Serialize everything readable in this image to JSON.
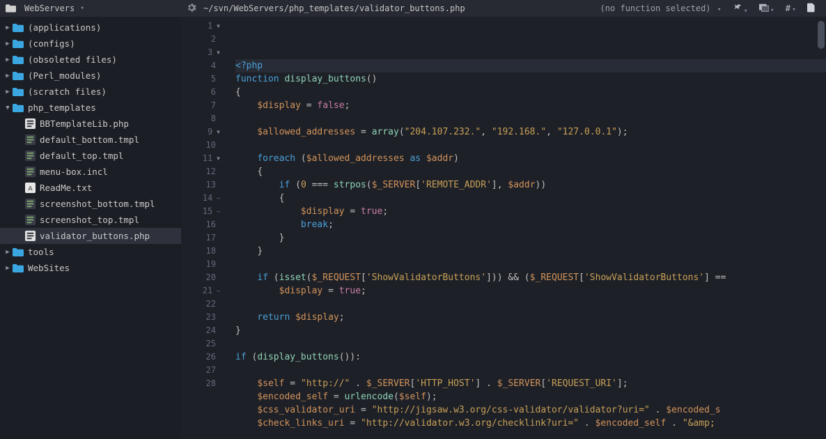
{
  "topbar": {
    "project": "WebServers",
    "path": "~/svn/WebServers/php_templates/validator_buttons.php",
    "fn_selector": "(no function selected)"
  },
  "tree": [
    {
      "kind": "folder",
      "name": "(applications)",
      "indent": 0,
      "open": false
    },
    {
      "kind": "folder",
      "name": "(configs)",
      "indent": 0,
      "open": false
    },
    {
      "kind": "folder",
      "name": "(obsoleted files)",
      "indent": 0,
      "open": false
    },
    {
      "kind": "folder",
      "name": "(Perl_modules)",
      "indent": 0,
      "open": false
    },
    {
      "kind": "folder",
      "name": "(scratch files)",
      "indent": 0,
      "open": false
    },
    {
      "kind": "folder",
      "name": "php_templates",
      "indent": 0,
      "open": true
    },
    {
      "kind": "php",
      "name": "BBTemplateLib.php",
      "indent": 1
    },
    {
      "kind": "file",
      "name": "default_bottom.tmpl",
      "indent": 1
    },
    {
      "kind": "file",
      "name": "default_top.tmpl",
      "indent": 1
    },
    {
      "kind": "file",
      "name": "menu-box.incl",
      "indent": 1
    },
    {
      "kind": "txt",
      "name": "ReadMe.txt",
      "indent": 1
    },
    {
      "kind": "file",
      "name": "screenshot_bottom.tmpl",
      "indent": 1
    },
    {
      "kind": "file",
      "name": "screenshot_top.tmpl",
      "indent": 1
    },
    {
      "kind": "php",
      "name": "validator_buttons.php",
      "indent": 1,
      "selected": true
    },
    {
      "kind": "folder",
      "name": "tools",
      "indent": 0,
      "open": false
    },
    {
      "kind": "folder",
      "name": "WebSites",
      "indent": 0,
      "open": false
    }
  ],
  "code": {
    "lines": [
      {
        "n": 1,
        "fold": "▼",
        "hl": true,
        "tokens": [
          [
            "kw",
            "<?php"
          ]
        ]
      },
      {
        "n": 2,
        "tokens": [
          [
            "kw",
            "function"
          ],
          [
            "op",
            " "
          ],
          [
            "fn",
            "display_buttons"
          ],
          [
            "punct",
            "()"
          ]
        ]
      },
      {
        "n": 3,
        "fold": "▼",
        "tokens": [
          [
            "punct",
            "{"
          ]
        ]
      },
      {
        "n": 4,
        "tokens": [
          [
            "op",
            "    "
          ],
          [
            "var",
            "$display"
          ],
          [
            "op",
            " = "
          ],
          [
            "const",
            "false"
          ],
          [
            "punct",
            ";"
          ]
        ]
      },
      {
        "n": 5,
        "tokens": []
      },
      {
        "n": 6,
        "tokens": [
          [
            "op",
            "    "
          ],
          [
            "var",
            "$allowed_addresses"
          ],
          [
            "op",
            " = "
          ],
          [
            "fn",
            "array"
          ],
          [
            "punct",
            "("
          ],
          [
            "str",
            "\"204.107.232.\""
          ],
          [
            "punct",
            ", "
          ],
          [
            "str",
            "\"192.168.\""
          ],
          [
            "punct",
            ", "
          ],
          [
            "str",
            "\"127.0.0.1\""
          ],
          [
            "punct",
            ");"
          ]
        ]
      },
      {
        "n": 7,
        "tokens": []
      },
      {
        "n": 8,
        "tokens": [
          [
            "op",
            "    "
          ],
          [
            "kw",
            "foreach"
          ],
          [
            "op",
            " ("
          ],
          [
            "var",
            "$allowed_addresses"
          ],
          [
            "op",
            " "
          ],
          [
            "kw",
            "as"
          ],
          [
            "op",
            " "
          ],
          [
            "var",
            "$addr"
          ],
          [
            "punct",
            ")"
          ]
        ]
      },
      {
        "n": 9,
        "fold": "▼",
        "tokens": [
          [
            "op",
            "    "
          ],
          [
            "punct",
            "{"
          ]
        ]
      },
      {
        "n": 10,
        "tokens": [
          [
            "op",
            "        "
          ],
          [
            "kw",
            "if"
          ],
          [
            "op",
            " ("
          ],
          [
            "num",
            "0"
          ],
          [
            "op",
            " === "
          ],
          [
            "fn",
            "strpos"
          ],
          [
            "punct",
            "("
          ],
          [
            "var",
            "$_SERVER"
          ],
          [
            "punct",
            "["
          ],
          [
            "str",
            "'REMOTE_ADDR'"
          ],
          [
            "punct",
            "], "
          ],
          [
            "var",
            "$addr"
          ],
          [
            "punct",
            "))"
          ]
        ]
      },
      {
        "n": 11,
        "fold": "▼",
        "tokens": [
          [
            "op",
            "        "
          ],
          [
            "punct",
            "{"
          ]
        ]
      },
      {
        "n": 12,
        "tokens": [
          [
            "op",
            "            "
          ],
          [
            "var",
            "$display"
          ],
          [
            "op",
            " = "
          ],
          [
            "const",
            "true"
          ],
          [
            "punct",
            ";"
          ]
        ]
      },
      {
        "n": 13,
        "tokens": [
          [
            "op",
            "            "
          ],
          [
            "kw",
            "break"
          ],
          [
            "punct",
            ";"
          ]
        ]
      },
      {
        "n": 14,
        "fold": "–",
        "tokens": [
          [
            "op",
            "        "
          ],
          [
            "punct",
            "}"
          ]
        ]
      },
      {
        "n": 15,
        "fold": "–",
        "tokens": [
          [
            "op",
            "    "
          ],
          [
            "punct",
            "}"
          ]
        ]
      },
      {
        "n": 16,
        "tokens": []
      },
      {
        "n": 17,
        "tokens": [
          [
            "op",
            "    "
          ],
          [
            "kw",
            "if"
          ],
          [
            "op",
            " ("
          ],
          [
            "fn",
            "isset"
          ],
          [
            "punct",
            "("
          ],
          [
            "var",
            "$_REQUEST"
          ],
          [
            "punct",
            "["
          ],
          [
            "str",
            "'ShowValidatorButtons'"
          ],
          [
            "punct",
            "])) && ("
          ],
          [
            "var",
            "$_REQUEST"
          ],
          [
            "punct",
            "["
          ],
          [
            "str",
            "'ShowValidatorButtons'"
          ],
          [
            "punct",
            "] =="
          ]
        ]
      },
      {
        "n": 18,
        "tokens": [
          [
            "op",
            "        "
          ],
          [
            "var",
            "$display"
          ],
          [
            "op",
            " = "
          ],
          [
            "const",
            "true"
          ],
          [
            "punct",
            ";"
          ]
        ]
      },
      {
        "n": 19,
        "tokens": []
      },
      {
        "n": 20,
        "tokens": [
          [
            "op",
            "    "
          ],
          [
            "kw",
            "return"
          ],
          [
            "op",
            " "
          ],
          [
            "var",
            "$display"
          ],
          [
            "punct",
            ";"
          ]
        ]
      },
      {
        "n": 21,
        "fold": "–",
        "tokens": [
          [
            "punct",
            "}"
          ]
        ]
      },
      {
        "n": 22,
        "tokens": []
      },
      {
        "n": 23,
        "tokens": [
          [
            "kw",
            "if"
          ],
          [
            "op",
            " ("
          ],
          [
            "fn",
            "display_buttons"
          ],
          [
            "punct",
            "()):"
          ]
        ]
      },
      {
        "n": 24,
        "tokens": []
      },
      {
        "n": 25,
        "tokens": [
          [
            "op",
            "    "
          ],
          [
            "var",
            "$self"
          ],
          [
            "op",
            " = "
          ],
          [
            "str",
            "\"http://\""
          ],
          [
            "op",
            " . "
          ],
          [
            "var",
            "$_SERVER"
          ],
          [
            "punct",
            "["
          ],
          [
            "str",
            "'HTTP_HOST'"
          ],
          [
            "punct",
            "] . "
          ],
          [
            "var",
            "$_SERVER"
          ],
          [
            "punct",
            "["
          ],
          [
            "str",
            "'REQUEST_URI'"
          ],
          [
            "punct",
            "];"
          ]
        ]
      },
      {
        "n": 26,
        "tokens": [
          [
            "op",
            "    "
          ],
          [
            "var",
            "$encoded_self"
          ],
          [
            "op",
            " = "
          ],
          [
            "fn",
            "urlencode"
          ],
          [
            "punct",
            "("
          ],
          [
            "var",
            "$self"
          ],
          [
            "punct",
            ");"
          ]
        ]
      },
      {
        "n": 27,
        "tokens": [
          [
            "op",
            "    "
          ],
          [
            "var",
            "$css_validator_uri"
          ],
          [
            "op",
            " = "
          ],
          [
            "str",
            "\"http://jigsaw.w3.org/css-validator/validator?uri=\""
          ],
          [
            "op",
            " . "
          ],
          [
            "var",
            "$encoded_s"
          ]
        ]
      },
      {
        "n": 28,
        "tokens": [
          [
            "op",
            "    "
          ],
          [
            "var",
            "$check_links_uri"
          ],
          [
            "op",
            " = "
          ],
          [
            "str",
            "\"http://validator.w3.org/checklink?uri=\""
          ],
          [
            "op",
            " . "
          ],
          [
            "var",
            "$encoded_self"
          ],
          [
            "op",
            " . "
          ],
          [
            "str",
            "\"&amp;"
          ]
        ]
      }
    ]
  }
}
